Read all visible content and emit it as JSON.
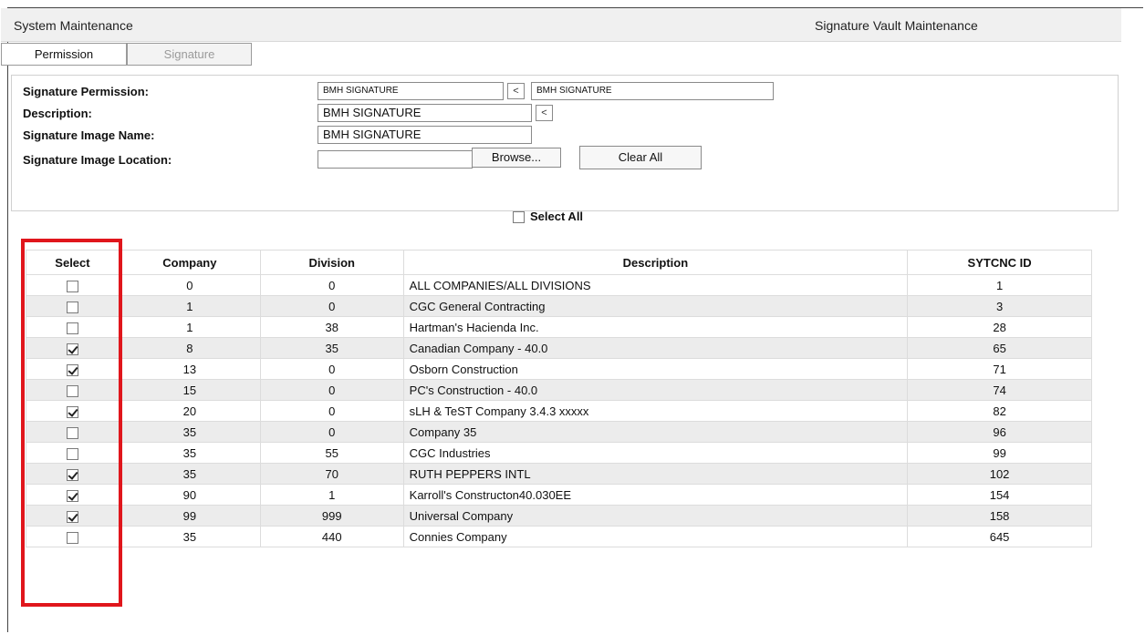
{
  "header": {
    "left_title": "System Maintenance",
    "right_title": "Signature Vault Maintenance"
  },
  "tabs": [
    {
      "label": "Permission",
      "active": true
    },
    {
      "label": "Signature",
      "active": false
    }
  ],
  "form": {
    "permission_label": "Signature Permission:",
    "permission_value": "BMH SIGNATURE",
    "permission_arrow": "<",
    "permission_value2": "BMH SIGNATURE",
    "description_label": "Description:",
    "description_value": "BMH SIGNATURE",
    "description_arrow": "<",
    "image_name_label": "Signature Image Name:",
    "image_name_value": "BMH SIGNATURE",
    "image_location_label": "Signature Image Location:",
    "image_location_value": "",
    "browse_label": "Browse...",
    "clear_all_label": "Clear All"
  },
  "select_all_label": "Select All",
  "table": {
    "columns": [
      "Select",
      "Company",
      "Division",
      "Description",
      "SYTCNC ID"
    ],
    "rows": [
      {
        "checked": false,
        "company": "0",
        "division": "0",
        "description": "ALL COMPANIES/ALL DIVISIONS",
        "id": "1"
      },
      {
        "checked": false,
        "company": "1",
        "division": "0",
        "description": "CGC General Contracting",
        "id": "3"
      },
      {
        "checked": false,
        "company": "1",
        "division": "38",
        "description": "Hartman's Hacienda Inc.",
        "id": "28"
      },
      {
        "checked": true,
        "company": "8",
        "division": "35",
        "description": "Canadian Company - 40.0",
        "id": "65"
      },
      {
        "checked": true,
        "company": "13",
        "division": "0",
        "description": "Osborn Construction",
        "id": "71"
      },
      {
        "checked": false,
        "company": "15",
        "division": "0",
        "description": "PC's Construction - 40.0",
        "id": "74"
      },
      {
        "checked": true,
        "company": "20",
        "division": "0",
        "description": "sLH & TeST Company 3.4.3 xxxxx",
        "id": "82"
      },
      {
        "checked": false,
        "company": "35",
        "division": "0",
        "description": "Company 35",
        "id": "96"
      },
      {
        "checked": false,
        "company": "35",
        "division": "55",
        "description": "CGC Industries",
        "id": "99"
      },
      {
        "checked": true,
        "company": "35",
        "division": "70",
        "description": "RUTH PEPPERS INTL",
        "id": "102"
      },
      {
        "checked": true,
        "company": "90",
        "division": "1",
        "description": "Karroll's Constructon40.030EE",
        "id": "154"
      },
      {
        "checked": true,
        "company": "99",
        "division": "999",
        "description": "Universal Company",
        "id": "158"
      },
      {
        "checked": false,
        "company": "35",
        "division": "440",
        "description": "Connies Company",
        "id": "645"
      }
    ]
  },
  "colors": {
    "highlight": "#e0161c",
    "row_alt": "#ececec"
  }
}
